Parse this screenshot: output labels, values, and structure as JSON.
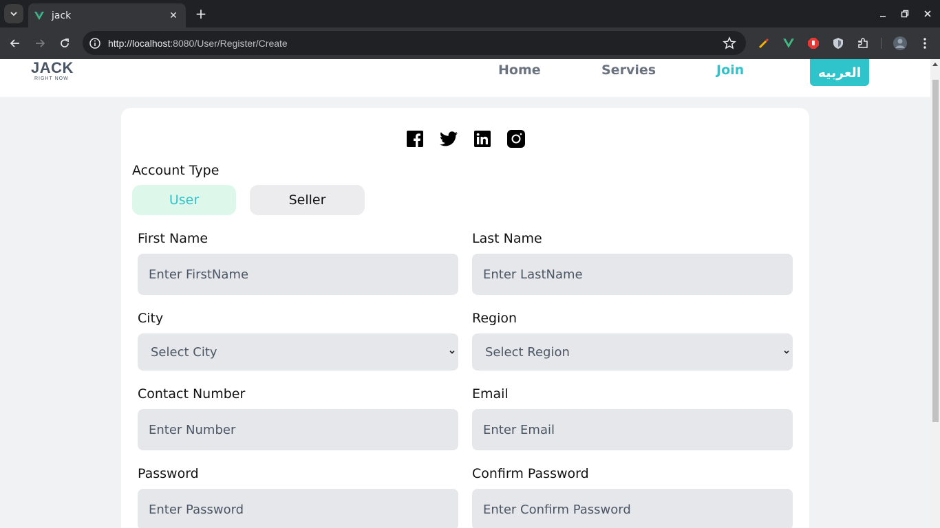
{
  "browser": {
    "tab_title": "jack",
    "url_host": "http://localhost",
    "url_path": ":8080/User/Register/Create"
  },
  "header": {
    "logo_main": "JACK",
    "logo_sub": "RIGHT NOW",
    "nav": {
      "home": "Home",
      "services": "Servies",
      "join": "Join"
    },
    "language_button": "العربيه"
  },
  "form": {
    "account_type_label": "Account Type",
    "account_types": {
      "user": "User",
      "seller": "Seller"
    },
    "selected_account_type": "User",
    "first_name": {
      "label": "First Name",
      "placeholder": "Enter FirstName"
    },
    "last_name": {
      "label": "Last Name",
      "placeholder": "Enter LastName"
    },
    "city": {
      "label": "City",
      "selected": "Select City"
    },
    "region": {
      "label": "Region",
      "selected": "Select Region"
    },
    "contact": {
      "label": "Contact Number",
      "placeholder": "Enter Number"
    },
    "email": {
      "label": "Email",
      "placeholder": "Enter Email"
    },
    "password": {
      "label": "Password",
      "placeholder": "Enter Password"
    },
    "confirm_password": {
      "label": "Confirm Password",
      "placeholder": "Enter Confirm Password"
    }
  },
  "socials": [
    "facebook-icon",
    "twitter-icon",
    "linkedin-icon",
    "instagram-icon"
  ],
  "colors": {
    "accent": "#2fc4cc",
    "selected_bg": "#ddf8ea",
    "field_bg": "#e5e7eb",
    "page_bg": "#f1f2f4"
  }
}
